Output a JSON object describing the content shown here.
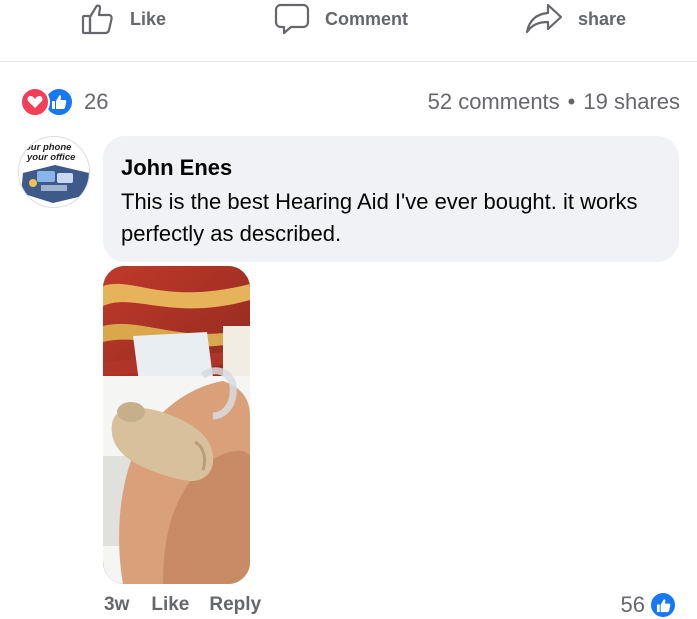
{
  "actions": {
    "like_label": "Like",
    "comment_label": "Comment",
    "share_label": "share"
  },
  "stats": {
    "reaction_count": "26",
    "comments": "52 comments",
    "separator": "•",
    "shares": "19 shares"
  },
  "comment": {
    "avatar_text_line1": "our phone",
    "avatar_text_line2": "your office",
    "author": "John Enes",
    "text": "This is the best Hearing Aid I've ever bought. it works perfectly as described.",
    "time": "3w",
    "like_label": "Like",
    "reply_label": "Reply",
    "reaction_count": "56"
  },
  "colors": {
    "like_blue": "#1877f2",
    "love_red": "#f33e58",
    "muted_text": "#65676b",
    "bubble_bg": "#f0f2f5"
  }
}
